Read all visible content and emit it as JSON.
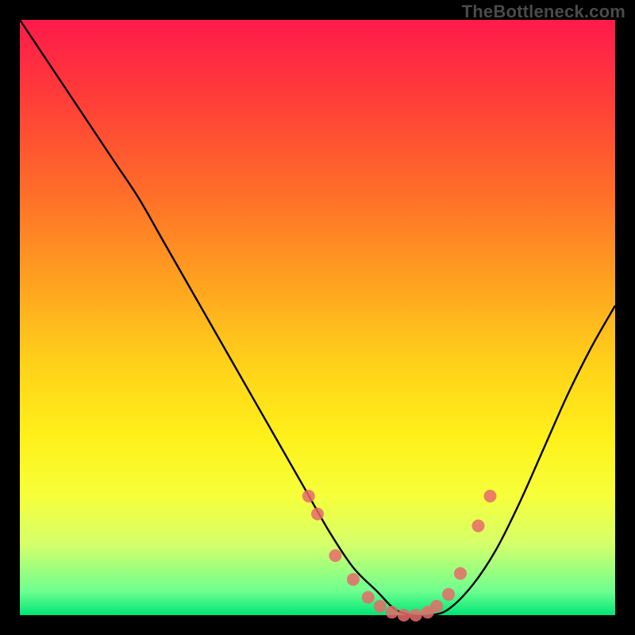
{
  "watermark": "TheBottleneck.com",
  "chart_data": {
    "type": "line",
    "title": "",
    "xlabel": "",
    "ylabel": "",
    "xlim": [
      0,
      100
    ],
    "ylim": [
      0,
      100
    ],
    "series": [
      {
        "name": "bottleneck-curve",
        "x": [
          0,
          4,
          8,
          12,
          16,
          20,
          24,
          28,
          32,
          36,
          40,
          44,
          48,
          52,
          56,
          60,
          63,
          66,
          69,
          72,
          76,
          80,
          84,
          88,
          92,
          96,
          100
        ],
        "y": [
          100,
          94,
          88,
          82,
          76,
          70,
          63,
          56,
          49,
          42,
          35,
          28,
          21,
          14,
          8,
          4,
          1,
          0,
          0,
          1,
          5,
          11,
          19,
          28,
          37,
          45,
          52
        ]
      }
    ],
    "markers": {
      "name": "highlight-points",
      "color": "#e86a6a",
      "x": [
        48.5,
        50.0,
        53.0,
        56.0,
        58.5,
        60.5,
        62.5,
        64.5,
        66.5,
        68.5,
        70.0,
        72.0,
        74.0,
        77.0,
        79.0
      ],
      "y": [
        20.0,
        17.0,
        10.0,
        6.0,
        3.0,
        1.5,
        0.5,
        0.0,
        0.0,
        0.5,
        1.5,
        3.5,
        7.0,
        15.0,
        20.0
      ]
    },
    "gradient_stops": [
      {
        "pos": 0.0,
        "color": "#ff1a4b"
      },
      {
        "pos": 0.28,
        "color": "#ff6a2a"
      },
      {
        "pos": 0.58,
        "color": "#ffd21a"
      },
      {
        "pos": 0.8,
        "color": "#f6ff3a"
      },
      {
        "pos": 0.96,
        "color": "#6dff8f"
      },
      {
        "pos": 1.0,
        "color": "#00e676"
      }
    ]
  }
}
